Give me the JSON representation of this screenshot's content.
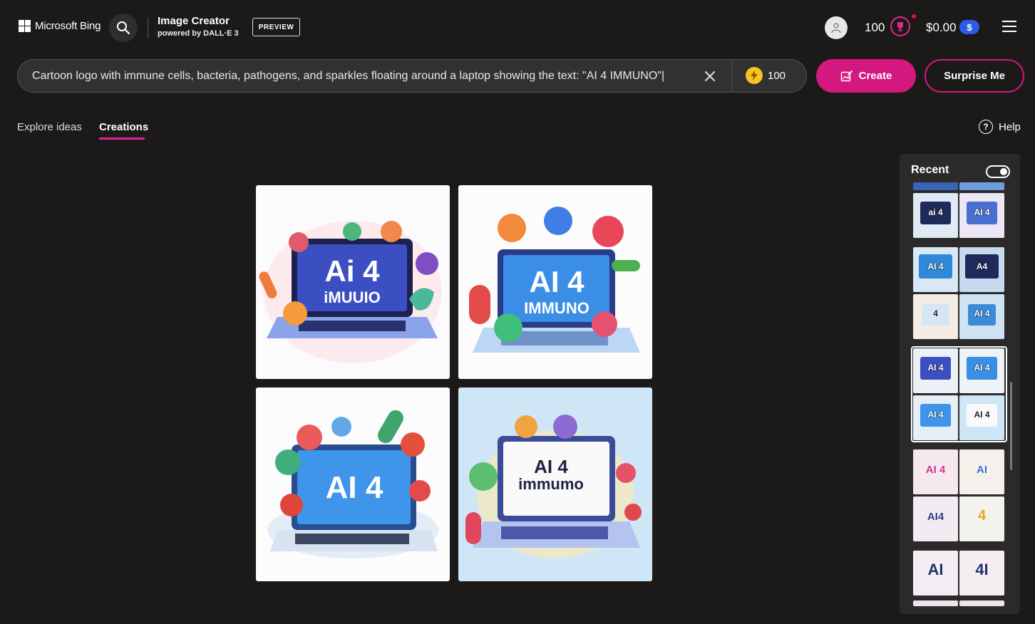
{
  "header": {
    "brand": "Microsoft Bing",
    "app_title": "Image Creator",
    "app_subtitle": "powered by DALL·E 3",
    "preview_badge": "PREVIEW",
    "points": "100",
    "balance": "$0.00",
    "currency_symbol": "$"
  },
  "prompt": {
    "text": "Cartoon logo with immune cells, bacteria, pathogens, and sparkles floating around a laptop showing the text: \"AI 4 IMMUNO\"|",
    "boosts": "100",
    "create_label": "Create",
    "surprise_label": "Surprise Me"
  },
  "tabs": [
    {
      "label": "Explore ideas",
      "active": false
    },
    {
      "label": "Creations",
      "active": true
    }
  ],
  "help_label": "Help",
  "help_glyph": "?",
  "images": [
    {
      "screen_text_line1": "Ai 4",
      "screen_text_line2": "iMUUIO"
    },
    {
      "screen_text_line1": "AI 4",
      "screen_text_line2": "IMMUNO"
    },
    {
      "screen_text_line1": "AI 4",
      "screen_text_line2": ""
    },
    {
      "screen_text_line1": "AI 4",
      "screen_text_line2": "immumo"
    }
  ],
  "recent": {
    "title": "Recent",
    "toggle_on": true,
    "thumbs": [
      {
        "label": "ai 4"
      },
      {
        "label": "AI 4"
      },
      {
        "label": "AI 4"
      },
      {
        "label": "A4"
      },
      {
        "label": "4"
      },
      {
        "label": "AI 4"
      },
      {
        "label": "AI 4"
      },
      {
        "label": "AI 4"
      },
      {
        "label": "AI 4"
      },
      {
        "label": "AI 4"
      },
      {
        "label": "AI 4"
      },
      {
        "label": "AI"
      },
      {
        "label": "AI4"
      },
      {
        "label": "4"
      },
      {
        "label": "AI"
      },
      {
        "label": "4I"
      }
    ]
  },
  "colors": {
    "accent": "#d3187f",
    "background": "#1b1a19",
    "prompt_bg": "#323130",
    "panel_bg": "#2b2a29",
    "dollar_pill": "#2f5bea"
  }
}
